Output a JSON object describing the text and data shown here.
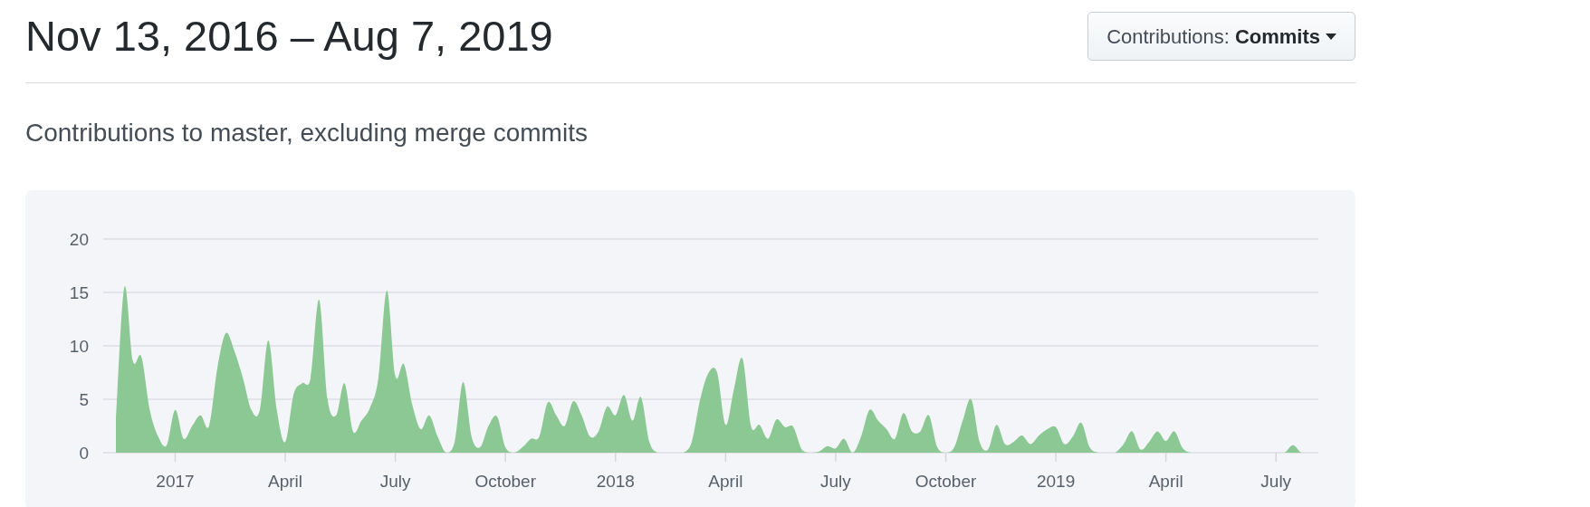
{
  "header": {
    "title": "Nov 13, 2016 – Aug 7, 2019",
    "dropdown": {
      "label": "Contributions:",
      "value": "Commits"
    }
  },
  "subtitle": "Contributions to master, excluding merge commits",
  "chart": {
    "chart_data": {
      "type": "area",
      "categories": [
        null,
        null,
        null,
        null,
        null,
        null,
        null,
        "2017",
        null,
        null,
        null,
        null,
        null,
        null,
        null,
        null,
        null,
        null,
        null,
        null,
        "April",
        null,
        null,
        null,
        null,
        null,
        null,
        null,
        null,
        null,
        null,
        null,
        null,
        "July",
        null,
        null,
        null,
        null,
        null,
        null,
        null,
        null,
        null,
        null,
        null,
        null,
        "October",
        null,
        null,
        null,
        null,
        null,
        null,
        null,
        null,
        null,
        null,
        null,
        null,
        "2018",
        null,
        null,
        null,
        null,
        null,
        null,
        null,
        null,
        null,
        null,
        null,
        null,
        "April",
        null,
        null,
        null,
        null,
        null,
        null,
        null,
        null,
        null,
        null,
        null,
        null,
        "July",
        null,
        null,
        null,
        null,
        null,
        null,
        null,
        null,
        null,
        null,
        null,
        null,
        "October",
        null,
        null,
        null,
        null,
        null,
        null,
        null,
        null,
        null,
        null,
        null,
        null,
        "2019",
        null,
        null,
        null,
        null,
        null,
        null,
        null,
        null,
        null,
        null,
        null,
        null,
        "April",
        null,
        null,
        null,
        null,
        null,
        null,
        null,
        null,
        null,
        null,
        null,
        null,
        "July",
        null,
        null,
        null,
        null,
        null
      ],
      "series": [
        {
          "color": "#8cc894",
          "values": [
            3,
            15.5,
            8.6,
            9,
            4,
            1.5,
            0.7,
            4,
            1.3,
            2.5,
            3.5,
            2.5,
            8,
            11.2,
            9.5,
            7,
            4,
            4,
            10.5,
            4,
            1,
            5.5,
            6.5,
            7,
            14.3,
            5,
            3.5,
            6.5,
            2,
            3,
            4.2,
            7,
            15.2,
            7.2,
            8.3,
            4.5,
            2.2,
            3.5,
            1.5,
            0,
            1,
            6.6,
            1.5,
            0.5,
            2.5,
            3.4,
            0.5,
            0,
            0.5,
            1.3,
            1.5,
            4.7,
            3.5,
            2.5,
            4.8,
            3.5,
            1.5,
            2,
            4.3,
            3.5,
            5.4,
            3,
            5.2,
            1,
            0,
            0,
            0,
            0,
            1,
            5,
            7.5,
            7.5,
            2.6,
            6,
            8.8,
            2.5,
            2.6,
            1.3,
            3.1,
            2.4,
            2.4,
            0.3,
            0,
            0.1,
            0.6,
            0.4,
            1.3,
            0,
            1.5,
            4,
            3,
            2.2,
            1.3,
            3.7,
            2,
            2,
            3.5,
            0.5,
            0,
            0.5,
            3,
            5,
            1,
            0.3,
            2.6,
            0.8,
            1,
            1.6,
            0.8,
            1.6,
            2.2,
            2.4,
            0.8,
            1.5,
            2.8,
            0.5,
            0,
            0,
            0,
            0.8,
            2,
            0.3,
            1,
            2,
            1.1,
            2,
            0.4,
            0,
            0,
            0,
            0,
            0,
            0,
            0,
            0,
            0,
            0,
            0,
            0,
            0.7,
            0,
            0,
            0
          ]
        }
      ],
      "ylim": [
        0,
        20
      ],
      "grid": true,
      "yticks": [
        0,
        5,
        10,
        15,
        20
      ]
    }
  }
}
